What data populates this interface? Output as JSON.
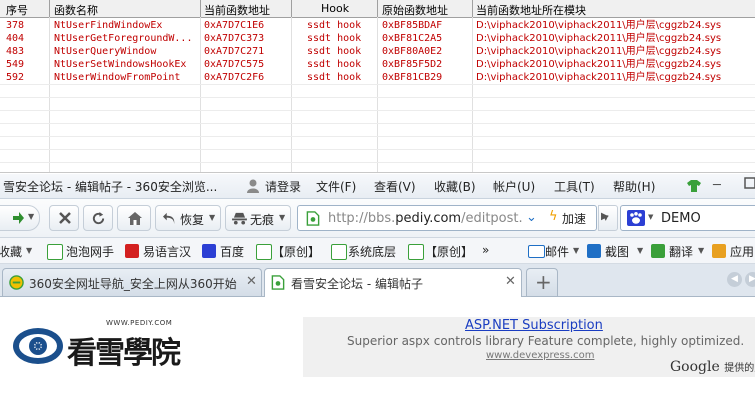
{
  "table": {
    "headers": [
      "序号",
      "函数名称",
      "当前函数地址",
      "Hook",
      "原始函数地址",
      "当前函数地址所在模块"
    ],
    "rows": [
      {
        "id": "378",
        "name": "NtUserFindWindowEx",
        "cur_addr": "0xA7D7C1E6",
        "hook": "ssdt hook",
        "orig_addr": "0xBF85BDAF",
        "module": "D:\\viphack2010\\viphack2011\\用户层\\cggzb24.sys"
      },
      {
        "id": "404",
        "name": "NtUserGetForegroundW...",
        "cur_addr": "0xA7D7C373",
        "hook": "ssdt hook",
        "orig_addr": "0xBF81C2A5",
        "module": "D:\\viphack2010\\viphack2011\\用户层\\cggzb24.sys"
      },
      {
        "id": "483",
        "name": "NtUserQueryWindow",
        "cur_addr": "0xA7D7C271",
        "hook": "ssdt hook",
        "orig_addr": "0xBF80A0E2",
        "module": "D:\\viphack2010\\viphack2011\\用户层\\cggzb24.sys"
      },
      {
        "id": "549",
        "name": "NtUserSetWindowsHookEx",
        "cur_addr": "0xA7D7C575",
        "hook": "ssdt hook",
        "orig_addr": "0xBF85F5D2",
        "module": "D:\\viphack2010\\viphack2011\\用户层\\cggzb24.sys"
      },
      {
        "id": "592",
        "name": "NtUserWindowFromPoint",
        "cur_addr": "0xA7D7C2F6",
        "hook": "ssdt hook",
        "orig_addr": "0xBF81CB29",
        "module": "D:\\viphack2010\\viphack2011\\用户层\\cggzb24.sys"
      }
    ]
  },
  "titlebar": {
    "title": "雪安全论坛 - 编辑帖子 - 360安全浏览...",
    "login": "请登录",
    "menu": [
      "文件(F)",
      "查看(V)",
      "收藏(B)",
      "帐户(U)",
      "工具(T)",
      "帮助(H)"
    ]
  },
  "nav": {
    "restore": "恢复",
    "incognito": "无痕",
    "url_prefix": "http://bbs.",
    "url_domain": "pediy.com",
    "url_suffix": "/editpost.",
    "accelerate": "加速",
    "search_value": "DEMO"
  },
  "bookmarks": [
    "收藏",
    "泡泡网手",
    "易语言汉",
    "百度",
    "【原创】",
    "系统底层",
    "【原创】",
    "»",
    "邮件",
    "截图",
    "翻译",
    "应用"
  ],
  "tabs": [
    {
      "label": "360安全网址导航_安全上网从360开始"
    },
    {
      "label": "看雪安全论坛 - 编辑帖子"
    }
  ],
  "page": {
    "logo_url": "WWW.PEDIY.COM",
    "logo_text": "看雪學院",
    "ad_title": "ASP.NET Subscription",
    "ad_desc": "Superior aspx controls library Feature complete, highly optimized.",
    "ad_url": "www.devexpress.com",
    "google": "Google",
    "google_suffix": "提供的广"
  },
  "colors": {
    "table_text": "#c00000",
    "link": "#1a3dc1",
    "tab_bg": "#dfe6ee"
  }
}
